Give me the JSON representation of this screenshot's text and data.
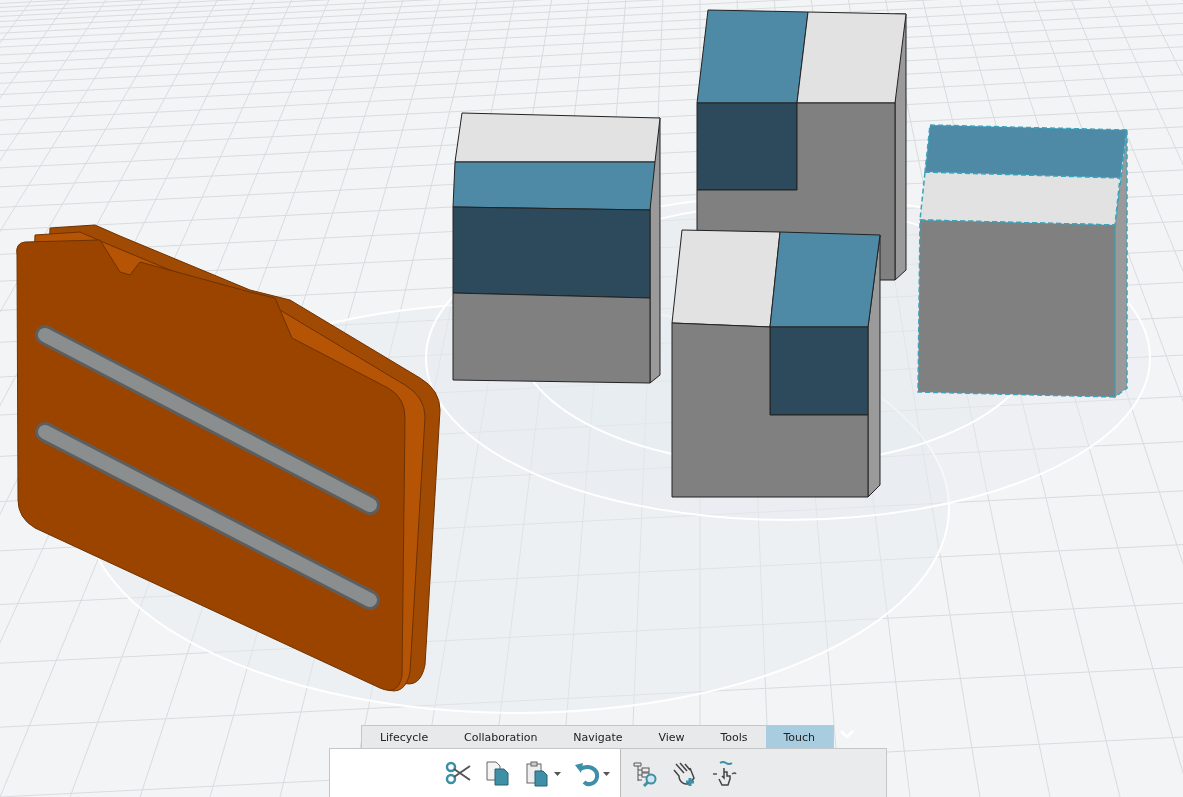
{
  "tabs": [
    {
      "label": "Lifecycle",
      "selected": false
    },
    {
      "label": "Collaboration",
      "selected": false
    },
    {
      "label": "Navigate",
      "selected": false
    },
    {
      "label": "View",
      "selected": false
    },
    {
      "label": "Tools",
      "selected": false
    },
    {
      "label": "Touch",
      "selected": true
    }
  ],
  "tool_groups": [
    [
      {
        "kind": "cut",
        "menu": false
      },
      {
        "kind": "copy",
        "menu": false
      },
      {
        "kind": "paste",
        "menu": true
      },
      {
        "kind": "undo",
        "menu": true
      }
    ],
    [
      {
        "kind": "tree-search",
        "menu": false
      },
      {
        "kind": "touch-add",
        "menu": false
      },
      {
        "kind": "touch-swipe",
        "menu": false
      }
    ]
  ]
}
